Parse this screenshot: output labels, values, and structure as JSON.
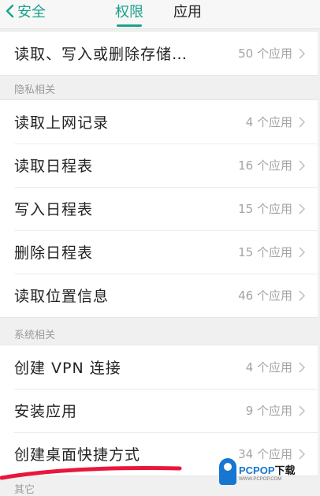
{
  "header": {
    "back_label": "安全",
    "tabs": [
      {
        "label": "权限",
        "active": true
      },
      {
        "label": "应用",
        "active": false
      }
    ]
  },
  "top_row": {
    "title": "读取、写入或删除存储…",
    "count": "50 个应用"
  },
  "groups": [
    {
      "label": "隐私相关",
      "items": [
        {
          "title": "读取上网记录",
          "count": "4 个应用"
        },
        {
          "title": "读取日程表",
          "count": "16 个应用"
        },
        {
          "title": "写入日程表",
          "count": "15 个应用"
        },
        {
          "title": "删除日程表",
          "count": "15 个应用"
        },
        {
          "title": "读取位置信息",
          "count": "46 个应用"
        }
      ]
    },
    {
      "label": "系统相关",
      "items": [
        {
          "title": "创建 VPN 连接",
          "count": "4 个应用"
        },
        {
          "title": "安装应用",
          "count": "9 个应用"
        },
        {
          "title": "创建桌面快捷方式",
          "count": "34 个应用"
        }
      ]
    }
  ],
  "cutoff_label": "其它",
  "watermark": {
    "brand": "PCPOP",
    "suffix": "下载",
    "sub": "WWW.PCPOP.COM"
  },
  "colors": {
    "accent": "#1aa38b",
    "annotation": "#e8173a",
    "watermark_blue": "#1776d1"
  }
}
